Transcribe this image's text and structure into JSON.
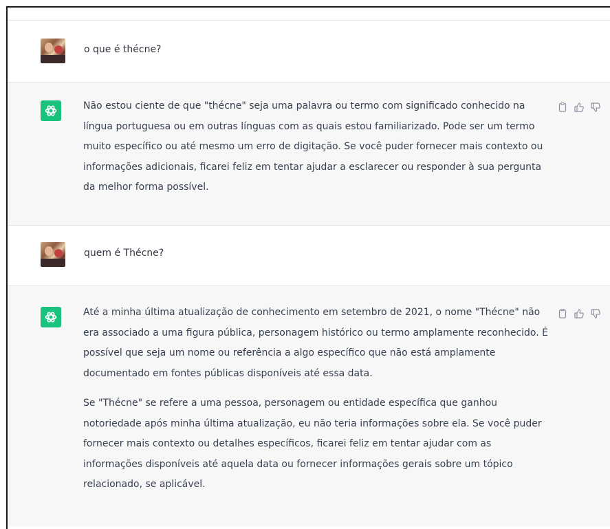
{
  "conversation": {
    "messages": [
      {
        "role": "user",
        "avatar_icon": "user-photo-avatar",
        "text": "o que é thécne?"
      },
      {
        "role": "assistant",
        "avatar_icon": "openai-logo-icon",
        "paragraphs": [
          "Não estou ciente de que \"thécne\" seja uma palavra ou termo com significado conhecido na língua portuguesa ou em outras línguas com as quais estou familiarizado. Pode ser um termo muito específico ou até mesmo um erro de digitação. Se você puder fornecer mais contexto ou informações adicionais, ficarei feliz em tentar ajudar a esclarecer ou responder à sua pergunta da melhor forma possível."
        ],
        "actions": [
          "copy-icon",
          "thumbs-up-icon",
          "thumbs-down-icon"
        ]
      },
      {
        "role": "user",
        "avatar_icon": "user-photo-avatar",
        "text": "quem é Thécne?"
      },
      {
        "role": "assistant",
        "avatar_icon": "openai-logo-icon",
        "paragraphs": [
          "Até a minha última atualização de conhecimento em setembro de 2021, o nome \"Thécne\" não era associado a uma figura pública, personagem histórico ou termo amplamente reconhecido. É possível que seja um nome ou referência a algo específico que não está amplamente documentado em fontes públicas disponíveis até essa data.",
          "Se \"Thécne\" se refere a uma pessoa, personagem ou entidade específica que ganhou notoriedade após minha última atualização, eu não teria informações sobre ela. Se você puder fornecer mais contexto ou detalhes específicos, ficarei feliz em tentar ajudar com as informações disponíveis até aquela data ou fornecer informações gerais sobre um tópico relacionado, se aplicável."
        ],
        "actions": [
          "copy-icon",
          "thumbs-up-icon",
          "thumbs-down-icon"
        ]
      }
    ]
  },
  "colors": {
    "assistant_bg": "#f7f7f8",
    "user_bg": "#ffffff",
    "gpt_avatar": "#19c37d",
    "text": "#374151",
    "icon": "#8e8ea0"
  }
}
